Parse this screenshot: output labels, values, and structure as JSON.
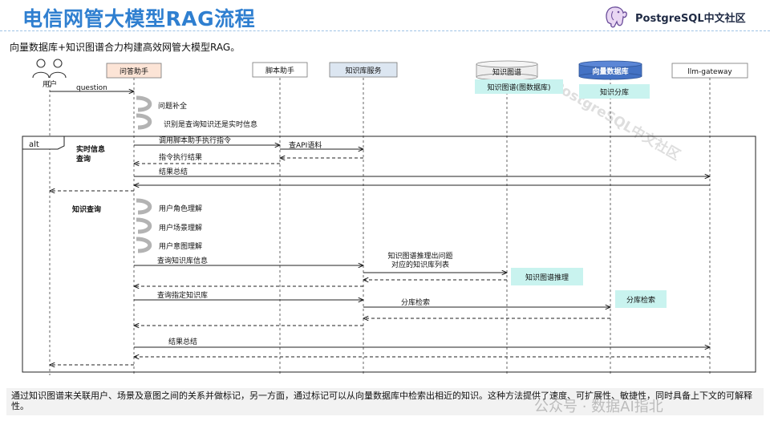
{
  "title": "电信网管大模型RAG流程",
  "subtitle": "向量数据库+知识图谱合力构建高效网管大模型RAG。",
  "brand": {
    "name": "PostgreSQL中文社区",
    "logo_icon": "elephant-logo-icon"
  },
  "watermark": "PostgreSQL中文社区",
  "participants": {
    "user": "用户",
    "qa": "问答助手",
    "script": "脚本助手",
    "kb": "知识库服务",
    "kg": "知识图谱",
    "vdb": "向量数据库",
    "llm": "llm-gateway"
  },
  "notes": {
    "kg_db": "知识图谱(图数据库)",
    "vdb_shard": "知识分库",
    "kg_reason": "知识图谱推理",
    "shard_search": "分库检索"
  },
  "alt": {
    "label": "alt",
    "section1": "实时信息查询",
    "section2": "知识查询"
  },
  "messages": {
    "question": "question",
    "complete": "问题补全",
    "identify": "识别是查询知识还是实时信息",
    "call_script": "调用脚本助手执行指令",
    "query_api": "查API语料",
    "exec_result": "指令执行结果",
    "summary1": "结果总结",
    "role": "用户角色理解",
    "scene": "用户场景理解",
    "intent": "用户意图理解",
    "query_kb_info": "查询知识库信息",
    "kg_infer": "知识图谱推理出问题对应的知识库列表",
    "query_kb": "查询指定知识库",
    "shard_retrieval": "分库检索",
    "summary2": "结果总结"
  },
  "footer": {
    "text": "通过知识图谱来关联用户、场景及意图之间的关系并做标记，另一方面，通过标记可以从向量数据库中检索出相近的知识。这种方法提供了速度、可扩展性、敏捷性，同时具备上下文的可解释性。",
    "watermark": "公众号 · 数据AI指北"
  },
  "colors": {
    "title": "#2f7fd0",
    "qa_box": "#fce4d6",
    "note": "#c9f3ef",
    "vdb": "#4472c4"
  }
}
